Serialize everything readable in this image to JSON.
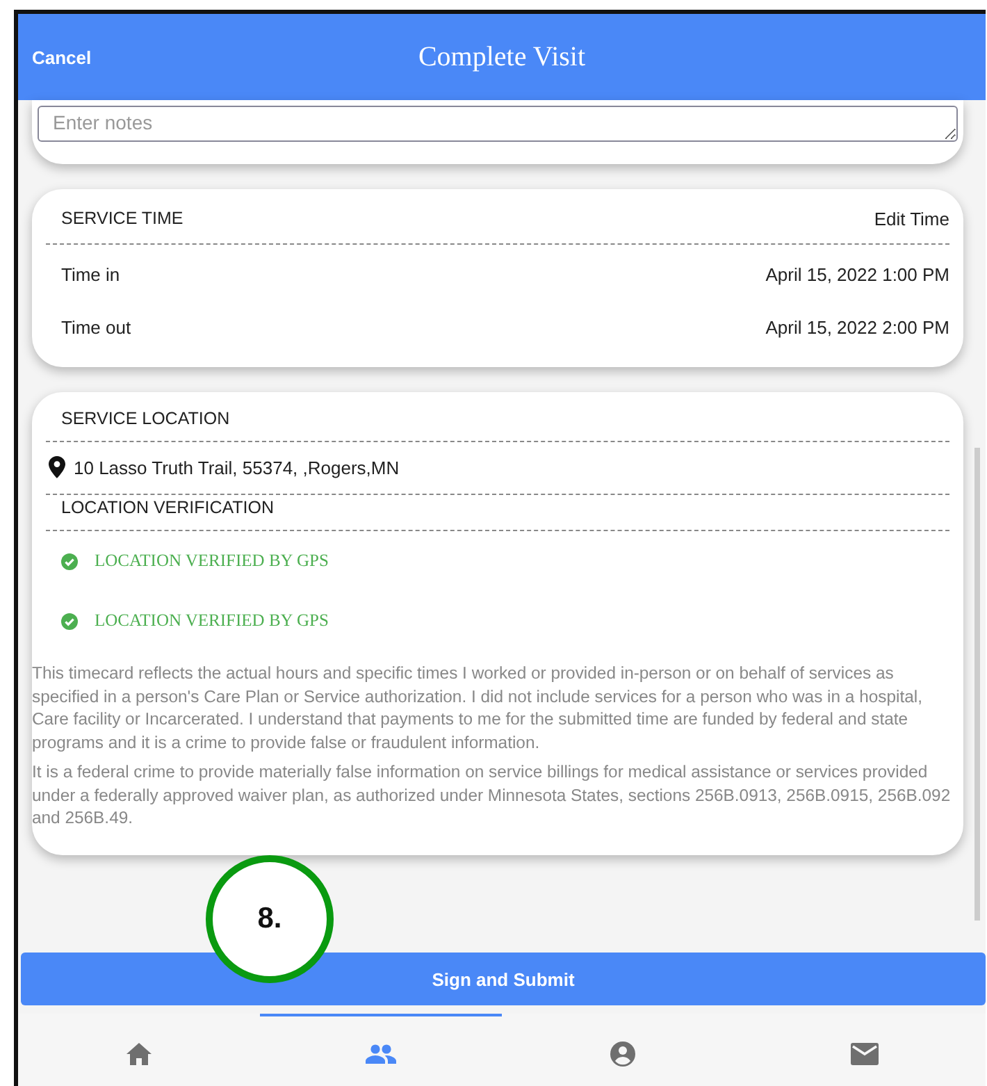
{
  "header": {
    "cancel": "Cancel",
    "title": "Complete Visit"
  },
  "notes": {
    "placeholder": "Enter notes"
  },
  "service_time": {
    "heading": "SERVICE TIME",
    "edit": "Edit Time",
    "rows": [
      {
        "label": "Time in",
        "value": "April 15, 2022 1:00 PM"
      },
      {
        "label": "Time out",
        "value": "April 15, 2022 2:00 PM"
      }
    ]
  },
  "service_location": {
    "heading": "SERVICE LOCATION",
    "address": "10 Lasso Truth Trail, 55374, ,Rogers,MN",
    "verification_heading": "LOCATION VERIFICATION",
    "verifications": [
      "LOCATION VERIFIED BY GPS",
      "LOCATION VERIFIED BY GPS"
    ],
    "disclaimers": [
      "This timecard reflects the actual hours and specific times I worked or provided in-person or on behalf of services as specified in a person's Care Plan or Service authorization. I did not include services for a person who was in a hospital, Care facility or Incarcerated. I understand that payments to me for the submitted time are funded by federal and state programs and it is a crime to provide false or fraudulent information.",
      "It is a federal crime to provide materially false information on service billings for medical assistance or services provided under a federally approved waiver plan, as authorized under Minnesota States, sections 256B.0913, 256B.0915, 256B.092 and 256B.49."
    ]
  },
  "submit_button": "Sign and Submit",
  "callout": "8.",
  "tabs": [
    {
      "kind": "home",
      "selected": false
    },
    {
      "kind": "people",
      "selected": true
    },
    {
      "kind": "account",
      "selected": false
    },
    {
      "kind": "mail",
      "selected": false
    }
  ]
}
